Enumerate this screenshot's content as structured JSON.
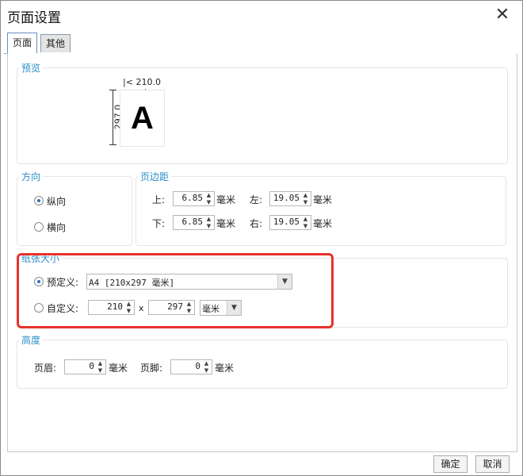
{
  "window": {
    "title": "页面设置",
    "close_icon": "close-icon"
  },
  "tabs": [
    {
      "label": "页面",
      "active": true
    },
    {
      "label": "其他",
      "active": false
    }
  ],
  "preview": {
    "legend": "预览",
    "page_glyph": "A",
    "width_label": "|< 210.0 >|",
    "height_label": "297.0"
  },
  "orientation": {
    "legend": "方向",
    "portrait": {
      "label": "纵向",
      "selected": true
    },
    "landscape": {
      "label": "横向",
      "selected": false
    }
  },
  "margins": {
    "legend": "页边距",
    "top": {
      "label": "上:",
      "value": "6.85",
      "unit": "毫米"
    },
    "left": {
      "label": "左:",
      "value": "19.05",
      "unit": "毫米"
    },
    "bottom": {
      "label": "下:",
      "value": "6.85",
      "unit": "毫米"
    },
    "right": {
      "label": "右:",
      "value": "19.05",
      "unit": "毫米"
    }
  },
  "paper": {
    "legend": "纸张大小",
    "predefined": {
      "label": "预定义:",
      "selected": true,
      "value": "A4 [210x297 毫米]"
    },
    "custom": {
      "label": "自定义:",
      "selected": false,
      "width": "210",
      "separator": "x",
      "height": "297",
      "unit": "毫米"
    }
  },
  "height": {
    "legend": "高度",
    "header": {
      "label": "页眉:",
      "value": "0",
      "unit": "毫米"
    },
    "footer": {
      "label": "页脚:",
      "value": "0",
      "unit": "毫米"
    }
  },
  "buttons": {
    "ok": "确定",
    "cancel": "取消"
  },
  "colors": {
    "accent_label": "#2a8fc8",
    "highlight": "#e8312b"
  }
}
